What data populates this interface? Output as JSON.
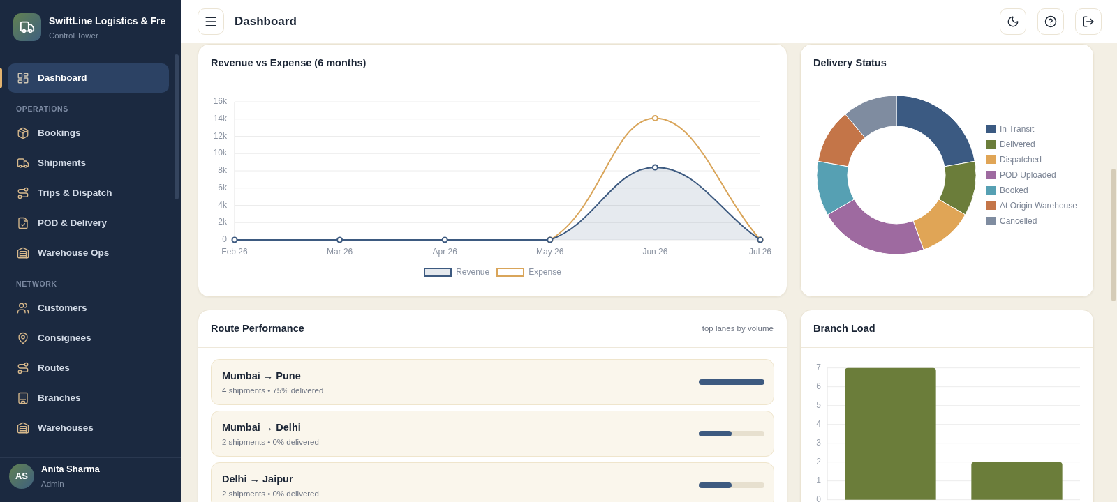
{
  "sidebar": {
    "brand": {
      "name": "SwiftLine Logistics & Fre",
      "subtitle": "Control Tower"
    },
    "sections": [
      {
        "items": [
          {
            "label": "Dashboard",
            "selected": true
          }
        ]
      },
      {
        "heading": "OPERATIONS",
        "items": [
          {
            "label": "Bookings",
            "selected": false
          },
          {
            "label": "Shipments",
            "selected": false
          },
          {
            "label": "Trips & Dispatch",
            "selected": false
          },
          {
            "label": "POD & Delivery",
            "selected": false
          },
          {
            "label": "Warehouse Ops",
            "selected": false
          }
        ]
      },
      {
        "heading": "NETWORK",
        "items": [
          {
            "label": "Customers",
            "selected": false
          },
          {
            "label": "Consignees",
            "selected": false
          },
          {
            "label": "Routes",
            "selected": false
          },
          {
            "label": "Branches",
            "selected": false
          },
          {
            "label": "Warehouses",
            "selected": false
          }
        ]
      }
    ],
    "user": {
      "initials": "AS",
      "name": "Anita Sharma",
      "role": "Admin"
    }
  },
  "header": {
    "title": "Dashboard"
  },
  "revenue": {
    "title": "Revenue vs Expense (6 months)",
    "chart_data": {
      "type": "line",
      "categories": [
        "Feb 26",
        "Mar 26",
        "Apr 26",
        "May 26",
        "Jun 26",
        "Jul 26"
      ],
      "series": [
        {
          "name": "Revenue",
          "color": "#3d5a80",
          "marker": "circle",
          "values": [
            0,
            0,
            0,
            0,
            8400,
            0
          ]
        },
        {
          "name": "Expense",
          "color": "#d9a55a",
          "marker": "circle",
          "values": [
            null,
            null,
            null,
            0,
            14100,
            0
          ]
        }
      ],
      "ylim": [
        0,
        16000
      ],
      "yticks": [
        {
          "value": 0,
          "label": "0"
        },
        {
          "value": 2000,
          "label": "2k"
        },
        {
          "value": 4000,
          "label": "4k"
        },
        {
          "value": 6000,
          "label": "6k"
        },
        {
          "value": 8000,
          "label": "8k"
        },
        {
          "value": 10000,
          "label": "10k"
        },
        {
          "value": 12000,
          "label": "12k"
        },
        {
          "value": 14000,
          "label": "14k"
        },
        {
          "value": 16000,
          "label": "16k"
        }
      ],
      "grid": true,
      "legend": "bottom"
    }
  },
  "delivery_status": {
    "title": "Delivery Status",
    "legend": [
      {
        "label": "In Transit",
        "color": "#3b5a82"
      },
      {
        "label": "Delivered",
        "color": "#6b7d3a"
      },
      {
        "label": "Dispatched",
        "color": "#e0a556"
      },
      {
        "label": "POD Uploaded",
        "color": "#9e6aa0"
      },
      {
        "label": "Booked",
        "color": "#56a0b3"
      },
      {
        "label": "At Origin Warehouse",
        "color": "#c47548"
      },
      {
        "label": "Cancelled",
        "color": "#7f8ca0"
      }
    ]
  },
  "routes": {
    "title": "Route Performance",
    "note": "top lanes by volume",
    "items": [
      {
        "title": "Mumbai → Pune",
        "detail": "4 shipments • 75% delivered",
        "level": 1
      },
      {
        "title": "Mumbai → Delhi",
        "detail": "2 shipments • 0% delivered",
        "level": 0.5
      },
      {
        "title": "Delhi → Jaipur",
        "detail": "2 shipments • 0% delivered",
        "level": 0.5
      }
    ]
  },
  "branch_load": {
    "title": "Branch Load",
    "chart_data": {
      "type": "bar",
      "values": [
        7,
        2
      ],
      "ylim": [
        0,
        7
      ],
      "yticks": [
        0,
        1,
        2,
        3,
        4,
        5,
        6,
        7
      ],
      "grid": true
    }
  }
}
